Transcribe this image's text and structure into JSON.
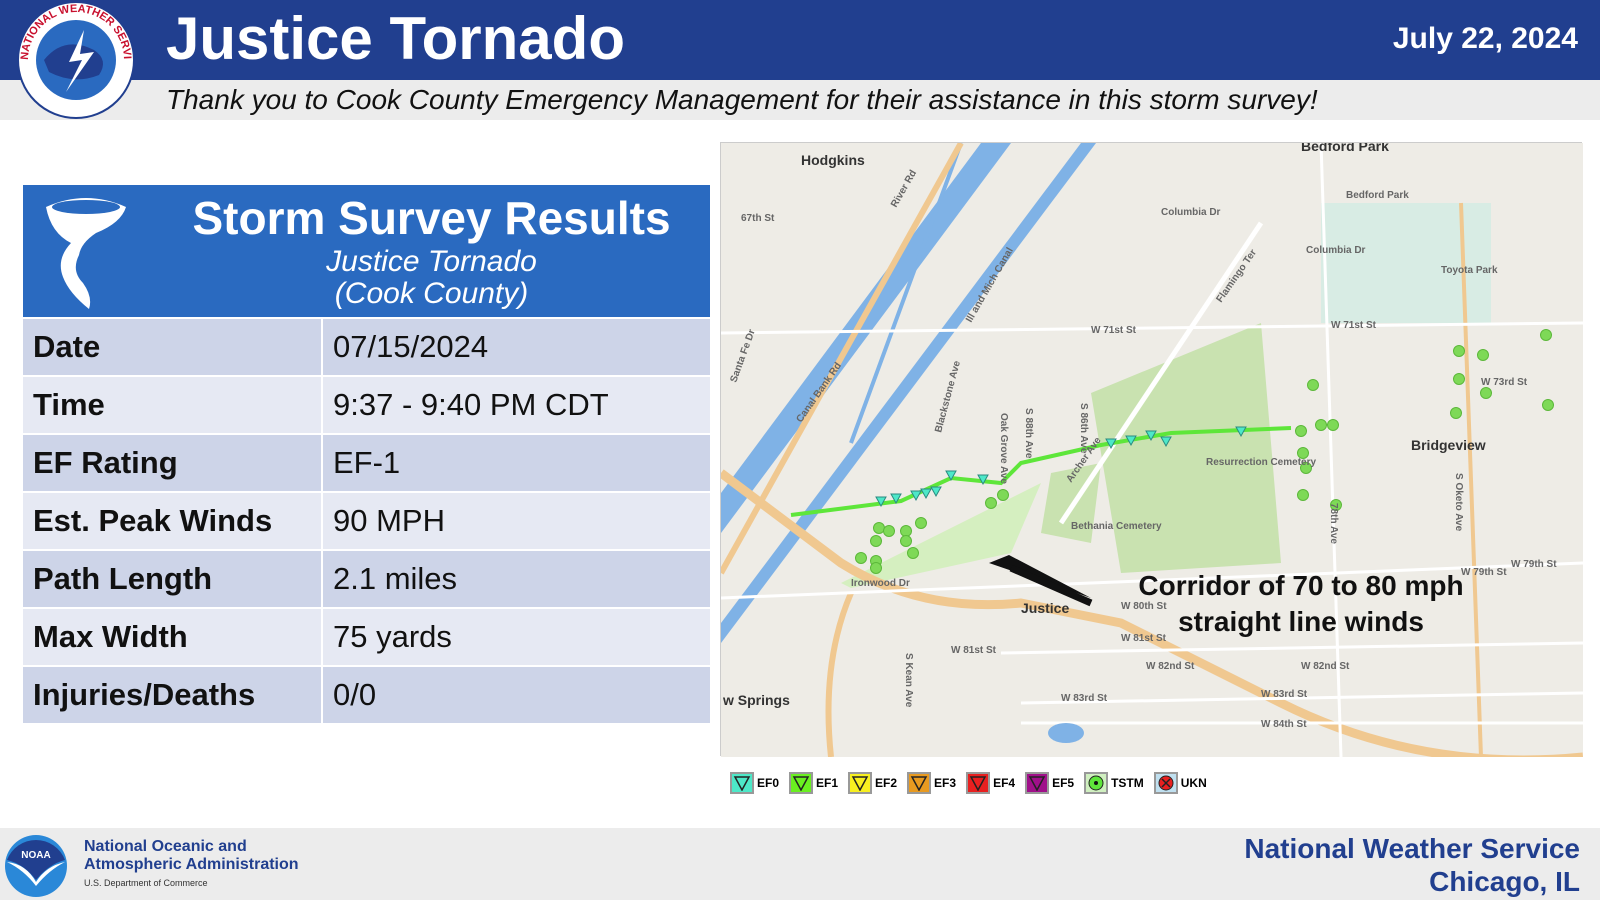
{
  "header": {
    "title": "Justice Tornado",
    "date": "July 22, 2024",
    "thanks": "Thank you to Cook County Emergency Management for their assistance in this storm survey!",
    "logo_text": "NATIONAL WEATHER SERVICE"
  },
  "card": {
    "heading": "Storm Survey Results",
    "subtitle1": "Justice Tornado",
    "subtitle2": "(Cook County)",
    "rows": [
      {
        "k": "Date",
        "v": "07/15/2024"
      },
      {
        "k": "Time",
        "v": "9:37 - 9:40 PM CDT"
      },
      {
        "k": "EF Rating",
        "v": "EF-1"
      },
      {
        "k": "Est. Peak Winds",
        "v": "90 MPH"
      },
      {
        "k": "Path Length",
        "v": "2.1 miles"
      },
      {
        "k": "Max Width",
        "v": "75 yards"
      },
      {
        "k": "Injuries/Deaths",
        "v": "0/0"
      }
    ]
  },
  "map": {
    "labels": [
      "Hodgkins",
      "Bedford Park",
      "67th St",
      "River Rd",
      "Columbia Dr",
      "Columbia Dr",
      "Bedford Park",
      "Toyota Park",
      "Ill and Mich Canal",
      "Flamingo Ter",
      "Santa Fe Dr",
      "Canal Bank Rd",
      "W 71st St",
      "W 71st St",
      "W 73rd St",
      "Blackstone Ave",
      "S 86th Ave",
      "Oak Grove Ave",
      "S 88th Ave",
      "Resurrection Cemetery",
      "Bridgeview",
      "Bethania Cemetery",
      "Archer Ave",
      "Ironwood Dr",
      "Justice",
      "W 79th St",
      "W 79th St",
      "W 80th St",
      "W 81st St",
      "W 81st St",
      "W 82nd St",
      "W 82nd St",
      "W 83rd St",
      "W 83rd St",
      "W 84th St",
      "S Kean Ave",
      "78th Ave",
      "S Oketo Ave",
      "w Springs"
    ],
    "annotation": [
      "Corridor of 70 to 80 mph",
      "straight line winds"
    ]
  },
  "legend": [
    {
      "label": "EF0",
      "color": "#4de8c8"
    },
    {
      "label": "EF1",
      "color": "#6af020"
    },
    {
      "label": "EF2",
      "color": "#f8f020"
    },
    {
      "label": "EF3",
      "color": "#e89a20"
    },
    {
      "label": "EF4",
      "color": "#e82020"
    },
    {
      "label": "EF5",
      "color": "#a0108a"
    },
    {
      "label": "TSTM",
      "color": "#d0f0c0"
    },
    {
      "label": "UKN",
      "color": "#c0e0f0"
    }
  ],
  "footer": {
    "noaa_line1": "National Oceanic and",
    "noaa_line2": "Atmospheric Administration",
    "noaa_dept": "U.S. Department of Commerce",
    "noaa_logo": "NOAA",
    "nws_line1": "National Weather Service",
    "nws_line2": "Chicago, IL"
  }
}
